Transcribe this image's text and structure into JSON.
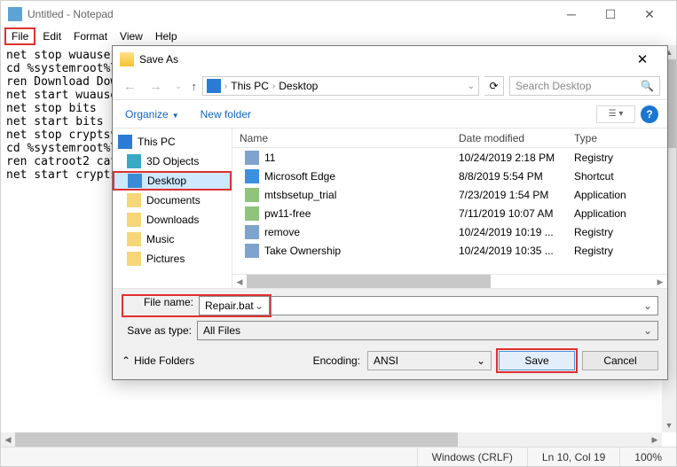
{
  "notepad": {
    "title": "Untitled - Notepad",
    "menu": {
      "file": "File",
      "edit": "Edit",
      "format": "Format",
      "view": "View",
      "help": "Help"
    },
    "body": "net stop wuauserv\ncd %systemroot%\\Syst\nren Download Downlo\nnet start wuauserv\nnet stop bits\nnet start bits\nnet stop cryptsvc\ncd %systemroot%\\syst\nren catroot2 catroo\nnet start cryptsvc",
    "status": {
      "eol": "Windows (CRLF)",
      "pos": "Ln 10, Col 19",
      "zoom": "100%"
    }
  },
  "saveas": {
    "title": "Save As",
    "path": {
      "pc": "This PC",
      "folder": "Desktop"
    },
    "search_placeholder": "Search Desktop",
    "toolbar": {
      "organize": "Organize",
      "newfolder": "New folder"
    },
    "tree": {
      "pc": "This PC",
      "items": [
        {
          "label": "3D Objects"
        },
        {
          "label": "Desktop",
          "selected": true
        },
        {
          "label": "Documents"
        },
        {
          "label": "Downloads"
        },
        {
          "label": "Music"
        },
        {
          "label": "Pictures"
        }
      ]
    },
    "columns": {
      "name": "Name",
      "date": "Date modified",
      "type": "Type"
    },
    "files": [
      {
        "name": "11",
        "date": "10/24/2019 2:18 PM",
        "type": "Registry",
        "icon": "reg"
      },
      {
        "name": "Microsoft Edge",
        "date": "8/8/2019 5:54 PM",
        "type": "Shortcut",
        "icon": "edge"
      },
      {
        "name": "mtsbsetup_trial",
        "date": "7/23/2019 1:54 PM",
        "type": "Application",
        "icon": "app"
      },
      {
        "name": "pw11-free",
        "date": "7/11/2019 10:07 AM",
        "type": "Application",
        "icon": "app"
      },
      {
        "name": "remove",
        "date": "10/24/2019 10:19 ...",
        "type": "Registry",
        "icon": "reg"
      },
      {
        "name": "Take Ownership",
        "date": "10/24/2019 10:35 ...",
        "type": "Registry",
        "icon": "reg"
      }
    ],
    "fields": {
      "fname_label": "File name:",
      "fname_value": "Repair.bat",
      "type_label": "Save as type:",
      "type_value": "All Files"
    },
    "bottom": {
      "hide": "Hide Folders",
      "encoding_label": "Encoding:",
      "encoding_value": "ANSI",
      "save": "Save",
      "cancel": "Cancel"
    }
  }
}
